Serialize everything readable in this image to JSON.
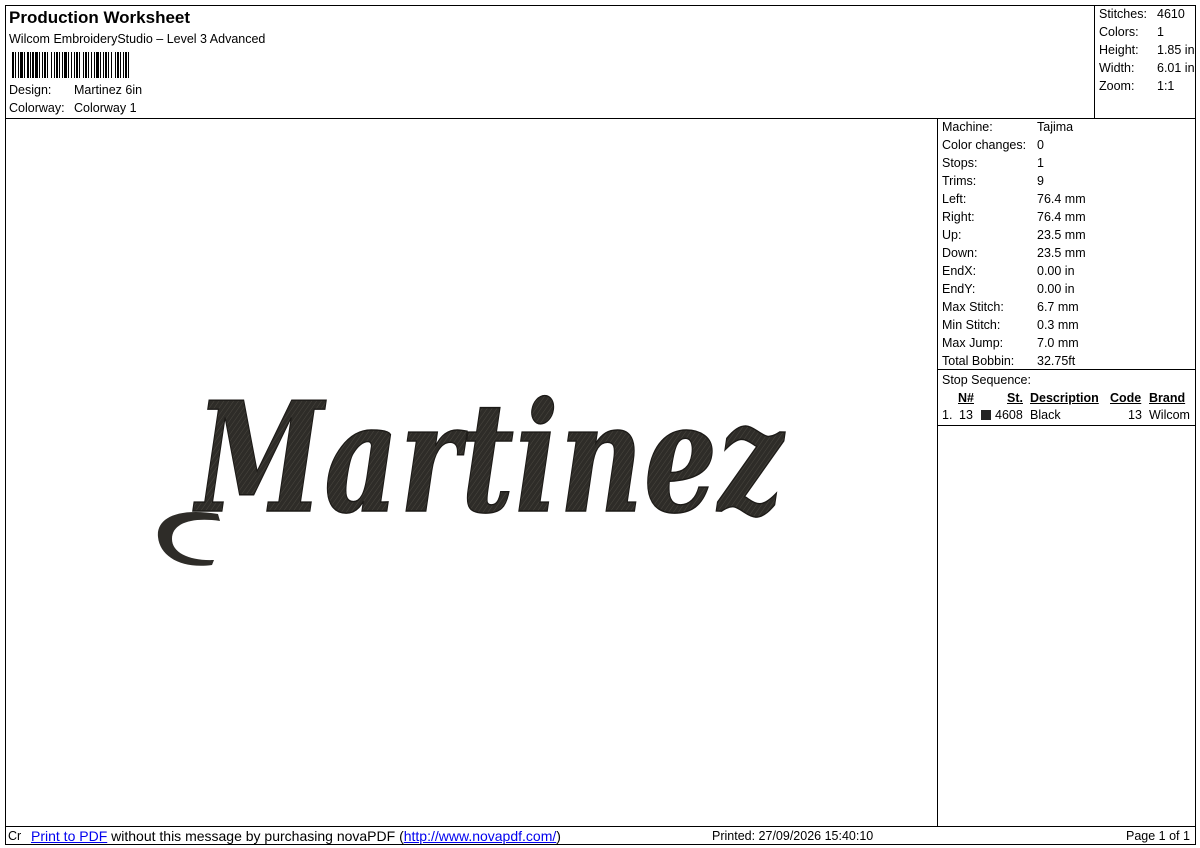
{
  "header": {
    "title": "Production Worksheet",
    "subtitle": "Wilcom EmbroideryStudio – Level 3 Advanced",
    "design_label": "Design:",
    "design_value": "Martinez 6in",
    "colorway_label": "Colorway:",
    "colorway_value": "Colorway 1"
  },
  "stats": {
    "stitches_label": "Stitches:",
    "stitches_value": "4610",
    "colors_label": "Colors:",
    "colors_value": "1",
    "height_label": "Height:",
    "height_value": "1.85 in",
    "width_label": "Width:",
    "width_value": "6.01 in",
    "zoom_label": "Zoom:",
    "zoom_value": "1:1"
  },
  "design": {
    "text": "Martinez",
    "thread_color": "#2e2c28"
  },
  "machine_info": [
    {
      "label": "Machine:",
      "value": "Tajima"
    },
    {
      "label": "Color changes:",
      "value": "0"
    },
    {
      "label": "Stops:",
      "value": "1"
    },
    {
      "label": "Trims:",
      "value": "9"
    },
    {
      "label": "Left:",
      "value": "76.4 mm"
    },
    {
      "label": "Right:",
      "value": "76.4 mm"
    },
    {
      "label": "Up:",
      "value": "23.5 mm"
    },
    {
      "label": "Down:",
      "value": "23.5 mm"
    },
    {
      "label": "EndX:",
      "value": "0.00 in"
    },
    {
      "label": "EndY:",
      "value": "0.00 in"
    },
    {
      "label": "Max Stitch:",
      "value": "6.7 mm"
    },
    {
      "label": "Min Stitch:",
      "value": "0.3 mm"
    },
    {
      "label": "Max Jump:",
      "value": "7.0 mm"
    },
    {
      "label": "Total Bobbin:",
      "value": "32.75ft"
    }
  ],
  "stop_sequence": {
    "title": "Stop Sequence:",
    "headers": [
      "N#",
      "St.",
      "Description",
      "Code",
      "Brand"
    ],
    "rows": [
      {
        "index": "1.",
        "n": "13",
        "swatch_color": "#222222",
        "stitches": "4608",
        "description": "Black",
        "code": "13",
        "brand": "Wilcom"
      }
    ]
  },
  "footer": {
    "prefix": "Cr",
    "print_link": "Print to PDF",
    "message": "without this message by purchasing novaPDF (",
    "url": "http://www.novapdf.com/",
    "close": ")",
    "printed": "Printed: 27/09/2026 15:40:10",
    "page": "Page 1 of 1"
  }
}
